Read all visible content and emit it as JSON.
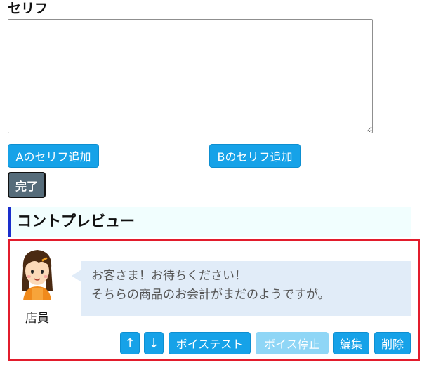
{
  "form": {
    "label": "セリフ",
    "textarea_value": "",
    "add_a_label": "Aのセリフ追加",
    "add_b_label": "Bのセリフ追加",
    "done_label": "完了"
  },
  "preview": {
    "heading": "コントプレビュー",
    "speaker_name": "店員",
    "line1": "お客さま！お待ちください！",
    "line2": "そちらの商品のお会計がまだのようですが。",
    "btn_up": "↑",
    "btn_down": "↓",
    "btn_voice_test": "ボイステスト",
    "btn_voice_stop": "ボイス停止",
    "btn_edit": "編集",
    "btn_delete": "削除"
  },
  "colors": {
    "button_blue": "#16a2e8",
    "button_disabled": "#8fd6f6",
    "done_button": "#566c7a",
    "preview_border": "#e21c2c",
    "heading_accent": "#1a2ecc",
    "bubble_bg": "#e1ecf8"
  },
  "icons": {
    "avatar": "shop-clerk-woman-avatar"
  }
}
